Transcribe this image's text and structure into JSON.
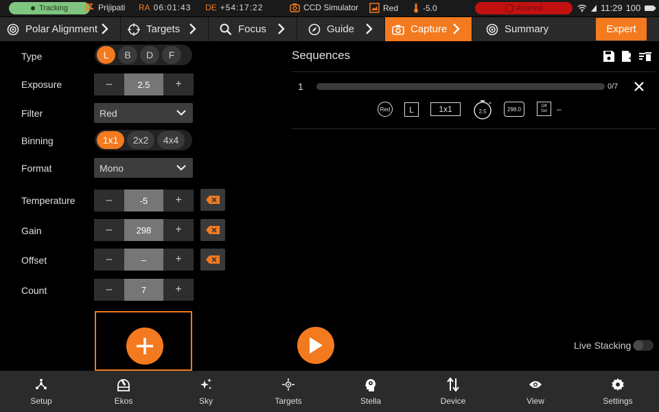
{
  "status_bar": {
    "tracking": "Tracking",
    "mount_name": "Prijipati",
    "ra_label": "RA",
    "ra_value": "06:01:43",
    "de_label": "DE",
    "de_value": "+54:17:22",
    "camera": "CCD Simulator",
    "filter": "Red",
    "temperature": "-5.0",
    "capture_status": "Aborted",
    "clock": "11:29",
    "battery": "100"
  },
  "tabs": [
    {
      "label": "Polar Alignment",
      "icon": "polar-alignment-icon"
    },
    {
      "label": "Targets",
      "icon": "crosshair-icon"
    },
    {
      "label": "Focus",
      "icon": "magnifier-icon"
    },
    {
      "label": "Guide",
      "icon": "compass-icon"
    },
    {
      "label": "Capture",
      "icon": "camera-icon",
      "active": true
    },
    {
      "label": "Summary",
      "icon": "target-icon"
    }
  ],
  "expert_label": "Expert",
  "settings": {
    "type": {
      "label": "Type",
      "options": [
        "L",
        "B",
        "D",
        "F"
      ],
      "selected": "L"
    },
    "exposure": {
      "label": "Exposure",
      "value": "2.5"
    },
    "filter": {
      "label": "Filter",
      "value": "Red"
    },
    "binning": {
      "label": "Binning",
      "options": [
        "1x1",
        "2x2",
        "4x4"
      ],
      "selected": "1x1"
    },
    "format": {
      "label": "Format",
      "value": "Mono"
    },
    "temperature": {
      "label": "Temperature",
      "value": "-5"
    },
    "gain": {
      "label": "Gain",
      "value": "298"
    },
    "offset": {
      "label": "Offset",
      "value": "–"
    },
    "count": {
      "label": "Count",
      "value": "7"
    },
    "minus": "–",
    "plus": "+"
  },
  "sequences": {
    "title": "Sequences",
    "items": [
      {
        "index": "1",
        "progress_text": "0/7",
        "progress_fraction": 0,
        "filter": "Red",
        "type": "L",
        "binning": "1x1",
        "exposure": "2.5",
        "gain": "298.0",
        "offset_line1": "Off",
        "offset_line2": "Set",
        "offset_value": "–"
      }
    ]
  },
  "live_stacking_label": "Live Stacking",
  "bottom_nav": [
    {
      "label": "Setup",
      "icon": "setup-icon"
    },
    {
      "label": "Ekos",
      "icon": "ekos-icon"
    },
    {
      "label": "Sky",
      "icon": "sky-icon"
    },
    {
      "label": "Targets",
      "icon": "targets-icon"
    },
    {
      "label": "Stella",
      "icon": "stella-icon"
    },
    {
      "label": "Device",
      "icon": "device-icon"
    },
    {
      "label": "View",
      "icon": "view-icon"
    },
    {
      "label": "Settings",
      "icon": "settings-icon"
    }
  ],
  "colors": {
    "accent": "#f47a1f",
    "tracking": "#7fc47f",
    "aborted": "#c21111"
  }
}
